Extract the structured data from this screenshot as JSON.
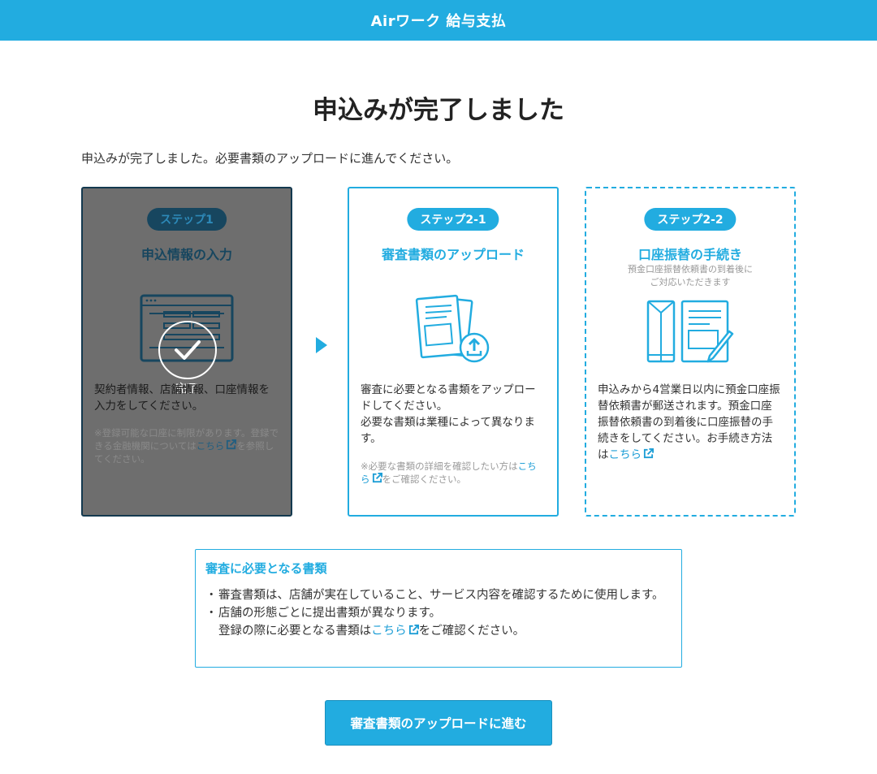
{
  "header": {
    "title": "Airワーク 給与支払"
  },
  "page_title": "申込みが完了しました",
  "intro_text": "申込みが完了しました。必要書類のアップロードに進んでください。",
  "colors": {
    "accent": "#22ace0",
    "completed_overlay": "#6e6e6e",
    "link": "#1e9ed6"
  },
  "steps": [
    {
      "badge": "ステップ1",
      "title": "申込情報の入力",
      "status": "完了",
      "icon": "form-icon",
      "status_icon": "checkmark-circle-icon",
      "body": "契約者情報、店舗情報、口座情報を入力をしてください。",
      "note_pre": "※登録可能な口座に制限があります。登録できる金融機関については",
      "note_link": "こちら",
      "note_post": "を参照してください。"
    },
    {
      "badge": "ステップ2-1",
      "title": "審査書類のアップロード",
      "icon": "document-upload-icon",
      "body_lines": [
        "審査に必要となる書類をアップロードしてください。",
        "必要な書類は業種によって異なります。"
      ],
      "note_pre": "※必要な書類の詳細を確認したい方は",
      "note_link": "こちら",
      "note_post": "をご確認ください。"
    },
    {
      "badge": "ステップ2-2",
      "title": "口座振替の手続き",
      "subtitle_lines": [
        "預金口座振替依頼書の到着後に",
        "ご対応いただきます"
      ],
      "icon": "envelope-pen-icon",
      "body_pre": "申込みから4営業日以内に預金口座振替依頼書が郵送されます。預金口座振替依頼書の到着後に口座振替の手続きをしてください。お手続き方法は",
      "body_link": "こちら"
    }
  ],
  "info_box": {
    "title": "審査に必要となる書類",
    "items": [
      {
        "text": "審査書類は、店舗が実在していること、サービス内容を確認するために使用します。"
      },
      {
        "line1": "店舗の形態ごとに提出書類が異なります。",
        "line2_pre": "登録の際に必要となる書類は",
        "line2_link": "こちら",
        "line2_post": "をご確認ください。"
      }
    ]
  },
  "cta": {
    "label": "審査書類のアップロードに進む"
  }
}
